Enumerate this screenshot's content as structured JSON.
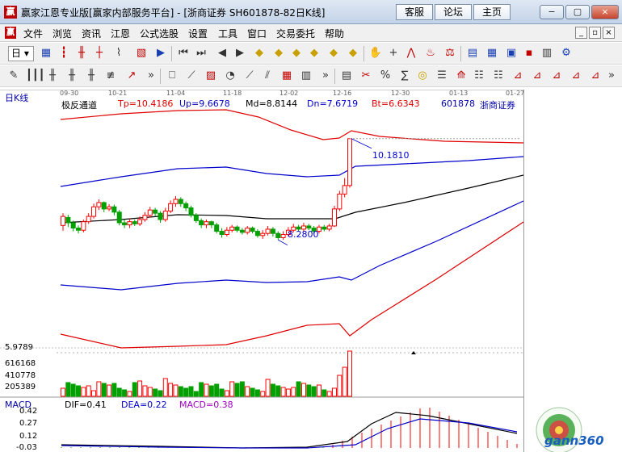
{
  "window": {
    "title": "赢家江恩专业版[赢家内部服务平台] - [浙商证券  SH601878-82日K线]",
    "links": [
      "客服",
      "论坛",
      "主页"
    ],
    "controls": [
      "−",
      "▢",
      "×"
    ]
  },
  "menu": {
    "items": [
      "文件",
      "浏览",
      "资讯",
      "江恩",
      "公式选股",
      "设置",
      "工具",
      "窗口",
      "交易委托",
      "帮助"
    ],
    "mdi_controls": [
      "_",
      "▫",
      "×"
    ]
  },
  "toolbar": {
    "period": "日"
  },
  "chart": {
    "period_label": "日K线",
    "indicator_name": "极反通道",
    "tp": "Tp=10.4186",
    "up": "Up=9.6678",
    "md": "Md=8.8144",
    "dn": "Dn=7.6719",
    "bt": "Bt=6.6343",
    "stock_code": "601878",
    "stock_name": "浙商证券",
    "dates": [
      "09-30",
      "10-21",
      "11-04",
      "11-18",
      "12-02",
      "12-16",
      "12-30",
      "01-13",
      "01-27"
    ],
    "high_annotation": "10.1810",
    "low_annotation": "8.2800",
    "volume_labels": [
      "5.9789",
      "616168",
      "410778",
      "205389"
    ],
    "macd_labels": [
      "0.42",
      "0.27",
      "0.12",
      "-0.03"
    ],
    "macd_title": "MACD",
    "dif": "DIF=0.41",
    "dea": "DEA=0.22",
    "macd": "MACD=0.38",
    "watermark": "gann360"
  },
  "colors": {
    "up": "#ff0000",
    "down": "#00a000",
    "upper_band": "#e00000",
    "inner_band": "#0000cc",
    "mid_line": "#000000",
    "macd_purple": "#a000c0"
  },
  "chart_data": {
    "type": "candlestick",
    "x_ticks": [
      "09-30",
      "10-21",
      "11-04",
      "11-18",
      "12-02",
      "12-16",
      "12-30",
      "01-13",
      "01-27"
    ],
    "indicator": "极反通道",
    "tp": 10.4186,
    "up": 9.6678,
    "md": 8.8144,
    "dn": 7.6719,
    "bt": 6.6343,
    "annotated_high": 10.181,
    "annotated_low": 8.28,
    "candles": [
      {
        "o": 8.55,
        "c": 8.72,
        "h": 8.78,
        "l": 8.45
      },
      {
        "o": 8.7,
        "c": 8.6,
        "h": 8.75,
        "l": 8.52
      },
      {
        "o": 8.6,
        "c": 8.5,
        "h": 8.64,
        "l": 8.44
      },
      {
        "o": 8.5,
        "c": 8.46,
        "h": 8.55,
        "l": 8.4
      },
      {
        "o": 8.46,
        "c": 8.62,
        "h": 8.66,
        "l": 8.42
      },
      {
        "o": 8.62,
        "c": 8.72,
        "h": 8.78,
        "l": 8.58
      },
      {
        "o": 8.72,
        "c": 8.9,
        "h": 8.96,
        "l": 8.68
      },
      {
        "o": 8.9,
        "c": 8.98,
        "h": 9.04,
        "l": 8.84
      },
      {
        "o": 8.98,
        "c": 8.86,
        "h": 9.0,
        "l": 8.8
      },
      {
        "o": 8.86,
        "c": 8.9,
        "h": 8.95,
        "l": 8.82
      },
      {
        "o": 8.9,
        "c": 8.8,
        "h": 8.94,
        "l": 8.74
      },
      {
        "o": 8.8,
        "c": 8.6,
        "h": 8.84,
        "l": 8.55
      },
      {
        "o": 8.6,
        "c": 8.56,
        "h": 8.66,
        "l": 8.5
      },
      {
        "o": 8.56,
        "c": 8.62,
        "h": 8.68,
        "l": 8.5
      },
      {
        "o": 8.62,
        "c": 8.58,
        "h": 8.66,
        "l": 8.54
      },
      {
        "o": 8.58,
        "c": 8.66,
        "h": 8.72,
        "l": 8.54
      },
      {
        "o": 8.66,
        "c": 8.74,
        "h": 8.8,
        "l": 8.62
      },
      {
        "o": 8.74,
        "c": 8.84,
        "h": 8.9,
        "l": 8.7
      },
      {
        "o": 8.84,
        "c": 8.78,
        "h": 8.88,
        "l": 8.72
      },
      {
        "o": 8.78,
        "c": 8.66,
        "h": 8.82,
        "l": 8.6
      },
      {
        "o": 8.66,
        "c": 8.82,
        "h": 8.88,
        "l": 8.62
      },
      {
        "o": 8.82,
        "c": 8.96,
        "h": 9.02,
        "l": 8.78
      },
      {
        "o": 8.96,
        "c": 9.04,
        "h": 9.1,
        "l": 8.9
      },
      {
        "o": 9.04,
        "c": 8.96,
        "h": 9.08,
        "l": 8.9
      },
      {
        "o": 8.96,
        "c": 8.88,
        "h": 9.0,
        "l": 8.82
      },
      {
        "o": 8.88,
        "c": 8.74,
        "h": 8.92,
        "l": 8.7
      },
      {
        "o": 8.74,
        "c": 8.64,
        "h": 8.78,
        "l": 8.6
      },
      {
        "o": 8.64,
        "c": 8.56,
        "h": 8.68,
        "l": 8.5
      },
      {
        "o": 8.56,
        "c": 8.62,
        "h": 8.66,
        "l": 8.5
      },
      {
        "o": 8.62,
        "c": 8.56,
        "h": 8.64,
        "l": 8.5
      },
      {
        "o": 8.56,
        "c": 8.44,
        "h": 8.6,
        "l": 8.4
      },
      {
        "o": 8.44,
        "c": 8.38,
        "h": 8.5,
        "l": 8.32
      },
      {
        "o": 8.38,
        "c": 8.46,
        "h": 8.52,
        "l": 8.34
      },
      {
        "o": 8.46,
        "c": 8.52,
        "h": 8.56,
        "l": 8.42
      },
      {
        "o": 8.52,
        "c": 8.46,
        "h": 8.55,
        "l": 8.42
      },
      {
        "o": 8.46,
        "c": 8.42,
        "h": 8.5,
        "l": 8.38
      },
      {
        "o": 8.42,
        "c": 8.5,
        "h": 8.54,
        "l": 8.38
      },
      {
        "o": 8.5,
        "c": 8.44,
        "h": 8.53,
        "l": 8.4
      },
      {
        "o": 8.44,
        "c": 8.36,
        "h": 8.48,
        "l": 8.32
      },
      {
        "o": 8.36,
        "c": 8.4,
        "h": 8.46,
        "l": 8.3
      },
      {
        "o": 8.4,
        "c": 8.48,
        "h": 8.54,
        "l": 8.36
      },
      {
        "o": 8.48,
        "c": 8.4,
        "h": 8.52,
        "l": 8.34
      },
      {
        "o": 8.4,
        "c": 8.32,
        "h": 8.44,
        "l": 8.28
      },
      {
        "o": 8.32,
        "c": 8.38,
        "h": 8.44,
        "l": 8.28
      },
      {
        "o": 8.38,
        "c": 8.46,
        "h": 8.52,
        "l": 8.34
      },
      {
        "o": 8.46,
        "c": 8.52,
        "h": 8.58,
        "l": 8.42
      },
      {
        "o": 8.52,
        "c": 8.48,
        "h": 8.56,
        "l": 8.44
      },
      {
        "o": 8.48,
        "c": 8.54,
        "h": 8.6,
        "l": 8.44
      },
      {
        "o": 8.54,
        "c": 8.5,
        "h": 8.58,
        "l": 8.46
      },
      {
        "o": 8.5,
        "c": 8.44,
        "h": 8.54,
        "l": 8.4
      },
      {
        "o": 8.44,
        "c": 8.52,
        "h": 8.56,
        "l": 8.4
      },
      {
        "o": 8.52,
        "c": 8.48,
        "h": 8.56,
        "l": 8.44
      },
      {
        "o": 8.48,
        "c": 8.54,
        "h": 8.58,
        "l": 8.44
      },
      {
        "o": 8.54,
        "c": 8.86,
        "h": 8.92,
        "l": 8.52
      },
      {
        "o": 8.86,
        "c": 9.14,
        "h": 9.2,
        "l": 8.82
      },
      {
        "o": 9.14,
        "c": 9.3,
        "h": 9.44,
        "l": 9.08
      },
      {
        "o": 9.3,
        "c": 10.181,
        "h": 10.181,
        "l": 9.26
      }
    ]
  }
}
